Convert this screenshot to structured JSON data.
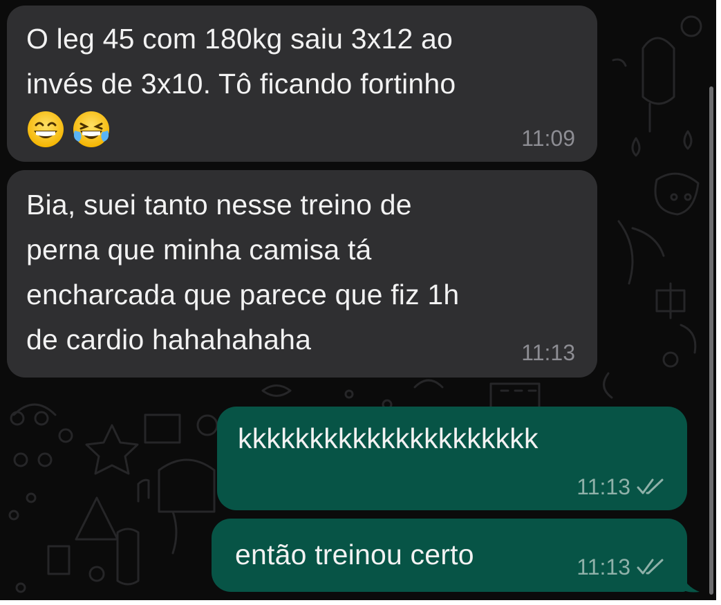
{
  "chat": {
    "messages": [
      {
        "direction": "incoming",
        "text": "O leg 45 com 180kg saiu 3x12 ao\ninvés de 3x10. Tô ficando fortinho",
        "emojis": [
          "grinning-face-with-smiling-eyes",
          "face-with-tears-of-joy"
        ],
        "time": "11:09"
      },
      {
        "direction": "incoming",
        "text": "Bia, suei tanto nesse treino de\nperna que minha camisa tá\nencharcada que parece que fiz 1h\nde cardio hahahahaha",
        "time": "11:13"
      },
      {
        "direction": "outgoing",
        "text": "kkkkkkkkkkkkkkkkkkkkk",
        "time": "11:13",
        "status_icon": "double-check-icon"
      },
      {
        "direction": "outgoing",
        "text": "então treinou certo",
        "time": "11:13",
        "status_icon": "double-check-icon"
      }
    ]
  },
  "colors": {
    "background": "#0b0b0b",
    "incoming_bubble": "#2f2f31",
    "outgoing_bubble": "#075446",
    "text": "#f2f2f2",
    "incoming_time": "#8d8d93",
    "outgoing_time": "#8fb1a9"
  }
}
